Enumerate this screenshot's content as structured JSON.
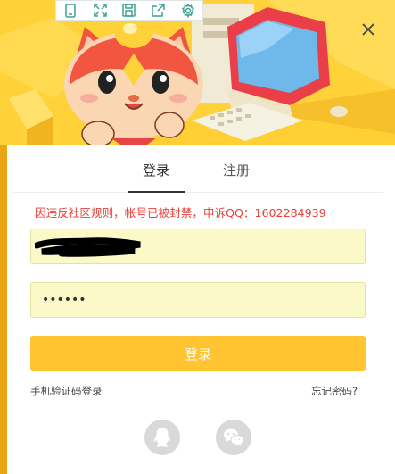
{
  "toolbar": {
    "icons": [
      "phone-icon",
      "expand-icon",
      "save-icon",
      "share-icon",
      "gear-icon"
    ]
  },
  "tabs": {
    "login_label": "登录",
    "register_label": "注册"
  },
  "notice": {
    "text": "因违反社区规则，帐号已被封禁，申诉QQ：1602284939"
  },
  "form": {
    "password_value": "••••••"
  },
  "actions": {
    "login_label": "登录",
    "phone_login_label": "手机验证码登录",
    "forgot_label": "忘记密码?"
  },
  "colors": {
    "accent": "#ffc430",
    "notice": "#e8403a",
    "input_bg": "#fbf9c8",
    "toolbar_icon": "#3fa090"
  }
}
